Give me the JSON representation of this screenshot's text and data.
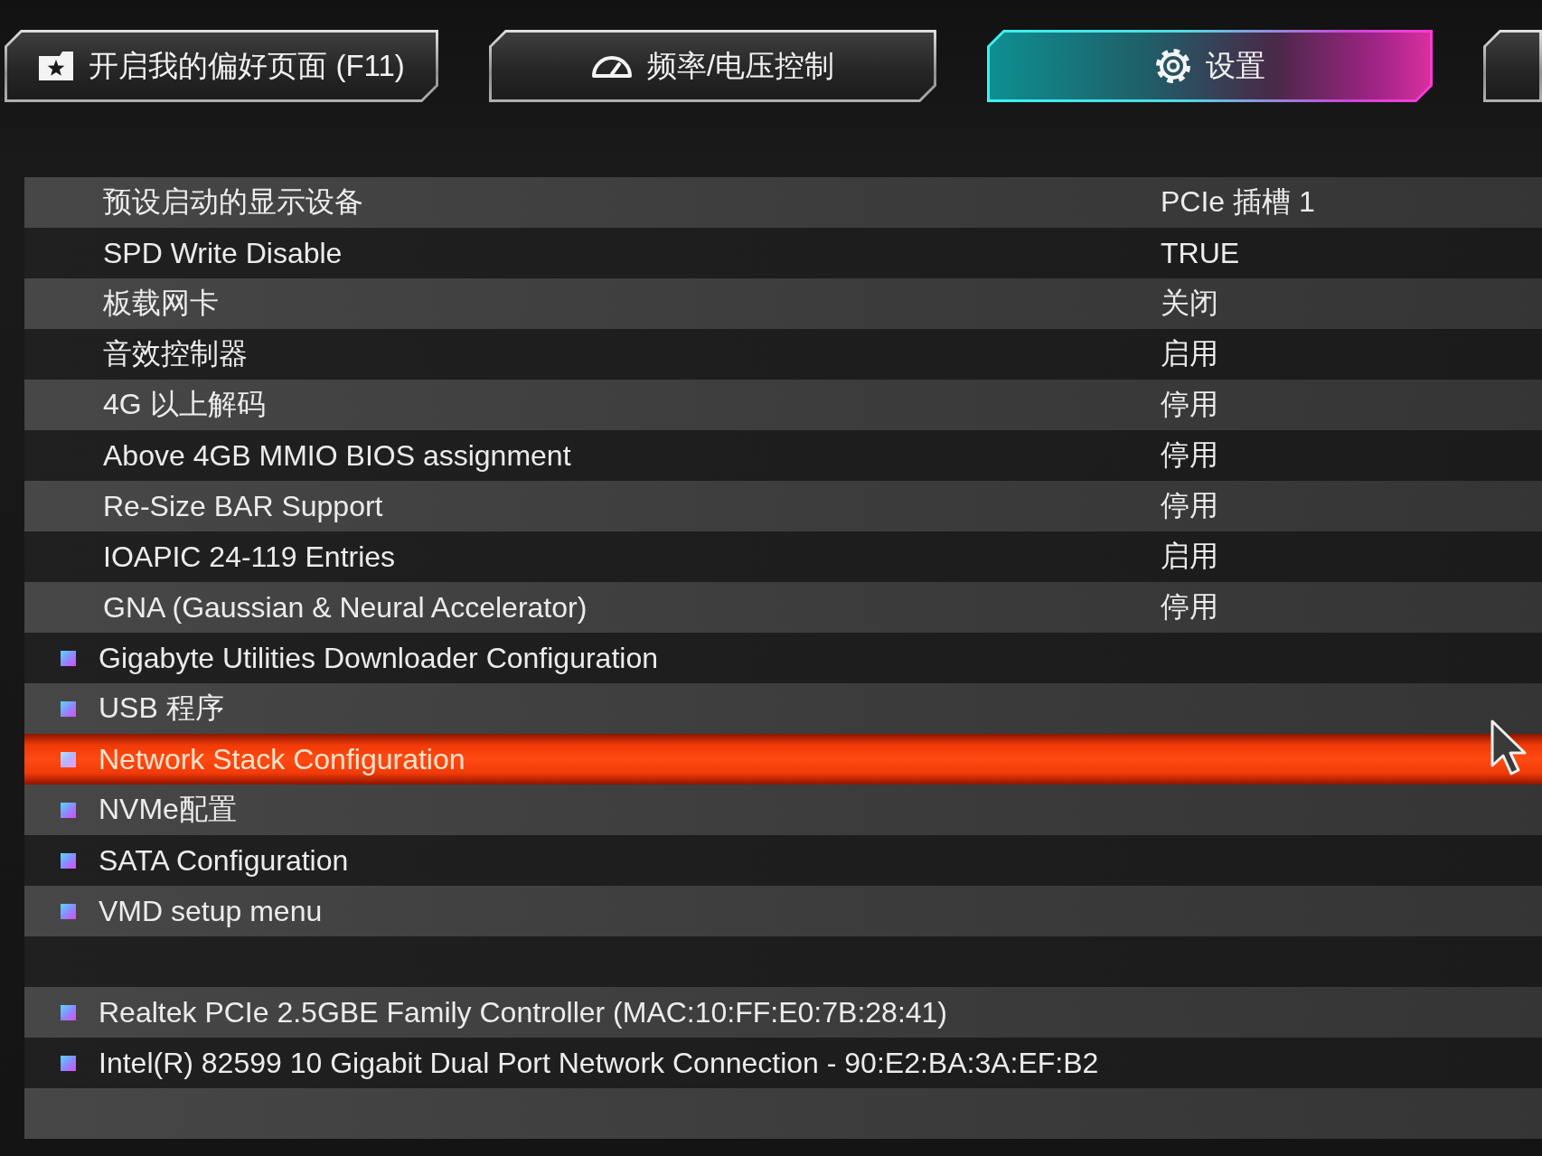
{
  "tabs": [
    {
      "label": "开启我的偏好页面 (F11)",
      "selected": false
    },
    {
      "label": "频率/电压控制",
      "selected": false
    },
    {
      "label": "设置",
      "selected": true
    },
    {
      "selected": false
    }
  ],
  "settings": [
    {
      "label": "预设启动的显示设备",
      "value": "PCIe 插槽 1",
      "selected": false
    },
    {
      "label": "SPD Write Disable",
      "value": "TRUE",
      "selected": false
    },
    {
      "label": "板载网卡",
      "value": "关闭",
      "selected": false
    },
    {
      "label": "音效控制器",
      "value": "启用",
      "selected": false
    },
    {
      "label": "4G 以上解码",
      "value": "停用",
      "selected": false
    },
    {
      "label": "Above 4GB MMIO BIOS assignment",
      "value": "停用",
      "selected": false
    },
    {
      "label": "Re-Size BAR Support",
      "value": "停用",
      "selected": false
    },
    {
      "label": "IOAPIC 24-119 Entries",
      "value": "启用",
      "selected": false
    },
    {
      "label": "GNA (Gaussian & Neural Accelerator)",
      "value": "停用",
      "selected": false
    }
  ],
  "submenus": [
    {
      "label": "Gigabyte Utilities Downloader Configuration",
      "selected": false
    },
    {
      "label": "USB 程序",
      "selected": false
    },
    {
      "label": "Network Stack Configuration",
      "selected": true
    },
    {
      "label": "NVMe配置",
      "selected": false
    },
    {
      "label": "SATA Configuration",
      "selected": false
    },
    {
      "label": "VMD setup menu",
      "selected": false
    }
  ],
  "network_devices": [
    {
      "label": "Realtek PCIe 2.5GBE Family Controller (MAC:10:FF:E0:7B:28:41)",
      "selected": false
    },
    {
      "label": "Intel(R) 82599 10 Gigabit Dual Port Network Connection - 90:E2:BA:3A:EF:B2",
      "selected": false
    }
  ]
}
